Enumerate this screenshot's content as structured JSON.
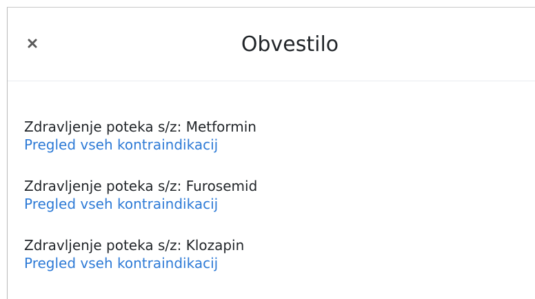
{
  "modal": {
    "title": "Obvestilo",
    "close_icon": "close-icon",
    "entries": [
      {
        "text": "Zdravljenje poteka s/z: Metformin",
        "link": "Pregled vseh kontraindikacij"
      },
      {
        "text": "Zdravljenje poteka s/z: Furosemid",
        "link": "Pregled vseh kontraindikacij"
      },
      {
        "text": "Zdravljenje poteka s/z: Klozapin",
        "link": "Pregled vseh kontraindikacij"
      }
    ]
  },
  "colors": {
    "link": "#2d7ad6",
    "text": "#212529",
    "close": "#555555"
  }
}
